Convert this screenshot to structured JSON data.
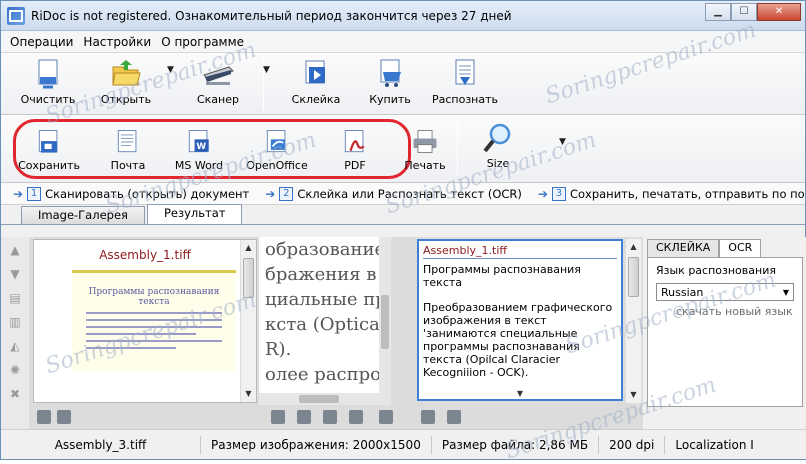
{
  "window": {
    "title": "RiDoc is not registered. Ознакомительный период закончится через 27 дней"
  },
  "menu": [
    "Операции",
    "Настройки",
    "О программе"
  ],
  "toolbar1": {
    "clear": "Очистить",
    "open": "Открыть",
    "scanner": "Сканер",
    "glue": "Склейка",
    "buy": "Купить",
    "recognize": "Распознать"
  },
  "toolbar2": {
    "save": "Сохранить",
    "mail": "Почта",
    "msword": "MS Word",
    "openoffice": "OpenOffice",
    "pdf": "PDF",
    "print": "Печать",
    "size": "Size"
  },
  "steps": [
    {
      "num": "1",
      "text": "Сканировать (открыть) документ"
    },
    {
      "num": "2",
      "text": "Склейка или Распознать текст (OCR)"
    },
    {
      "num": "3",
      "text": "Сохранить, печатать, отправить по почте документ"
    }
  ],
  "tabs": {
    "gallery": "Image-Галерея",
    "result": "Результат"
  },
  "thumb": {
    "filename": "Assembly_1.tiff",
    "heading": "Программы распознавания текста"
  },
  "scan_lines": [
    "образованием г",
    "бражения в тс",
    "циальные прос",
    "кста (Optical C",
    "R).",
    "олее распрост"
  ],
  "ocr": {
    "title": "Assembly_1.tiff",
    "line1": "Программы распознавания текста",
    "body": "Преобразованием графического изображения в текст 'занимаются специальные программы распознавания текста (Opilcal Claracier Kecogniiion - OCK)."
  },
  "right_panel": {
    "tab_glue": "СКЛЕЙКА",
    "tab_ocr": "OCR",
    "lang_label": "Язык распознования",
    "lang_value": "Russian",
    "download": "скачать новый язык"
  },
  "status": {
    "file": "Assembly_3.tiff",
    "image_size": "Размер изображения: 2000x1500",
    "file_size": "Размер файла: 2,86 МБ",
    "dpi": "200 dpi",
    "localization": "Localization I"
  },
  "watermark": "Soringpcrepair.com",
  "colors": {
    "highlight_oval": "#e2262e",
    "accent": "#3573c8"
  }
}
